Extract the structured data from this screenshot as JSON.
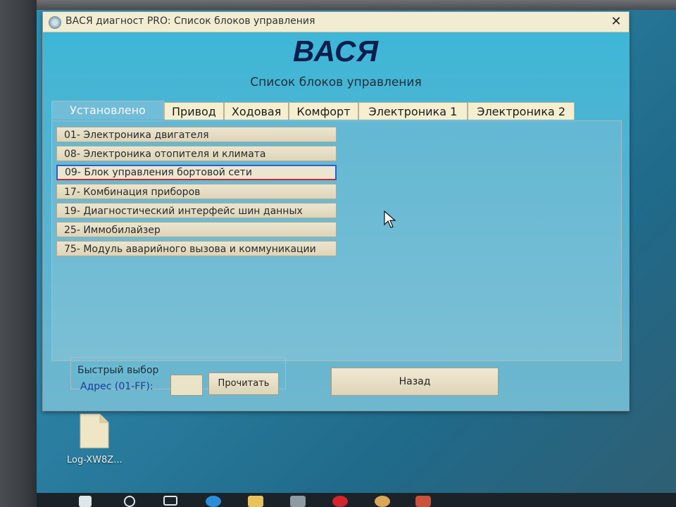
{
  "window": {
    "title": "ВАСЯ диагност PRO:  Список блоков управления",
    "close_glyph": "✕"
  },
  "header": {
    "app_name": "ВАСЯ",
    "subtitle": "Список блоков управления"
  },
  "tabs": [
    {
      "label": "Установлено",
      "active": true
    },
    {
      "label": "Привод",
      "active": false
    },
    {
      "label": "Ходовая",
      "active": false
    },
    {
      "label": "Комфорт",
      "active": false
    },
    {
      "label": "Электроника 1",
      "active": false
    },
    {
      "label": "Электроника 2",
      "active": false
    }
  ],
  "modules": [
    {
      "label": "01- Электроника двигателя",
      "selected": false
    },
    {
      "label": "08- Электроника отопителя и климата",
      "selected": false
    },
    {
      "label": "09- Блок управления бортовой сети",
      "selected": true
    },
    {
      "label": "17- Комбинация приборов",
      "selected": false
    },
    {
      "label": "19- Диагностический интерфейс шин данных",
      "selected": false
    },
    {
      "label": "25- Иммобилайзер",
      "selected": false
    },
    {
      "label": "75- Модуль аварийного вызова и коммуникации",
      "selected": false
    }
  ],
  "quick_select": {
    "legend": "Быстрый выбор",
    "address_label": "Адрес (01-FF):",
    "address_value": "",
    "read_button": "Прочитать"
  },
  "back_button": "Назад",
  "desktop": {
    "file_label": "Log-XW8Z..."
  },
  "colors": {
    "accent_blue": "#2b5fcf",
    "selection_red": "#d4262b",
    "title_navy": "#0a1e50"
  }
}
